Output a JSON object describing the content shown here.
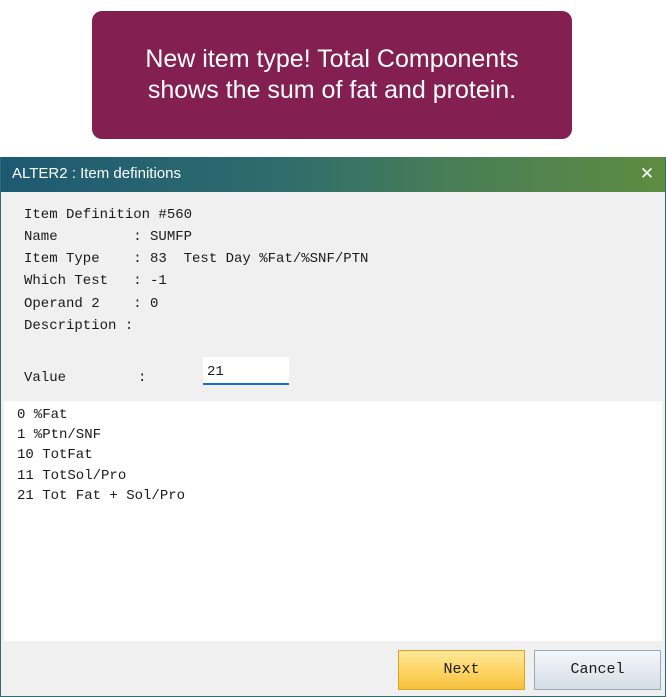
{
  "callout": {
    "line1": "New item type! Total Components",
    "line2": "shows the sum of fat and protein."
  },
  "window": {
    "title": "ALTER2 : Item definitions",
    "close_icon": "✕"
  },
  "definition": {
    "lines": [
      "Item Definition #560",
      "Name         : SUMFP",
      "Item Type    : 83  Test Day %Fat/%SNF/PTN",
      "Which Test   : -1",
      "Operand 2    : 0",
      "Description :"
    ]
  },
  "value_field": {
    "label": "Value",
    "colon": ":",
    "value": "21"
  },
  "options": [
    "0 %Fat",
    "1 %Ptn/SNF",
    "10 TotFat",
    "11 TotSol/Pro",
    "21 Tot Fat + Sol/Pro"
  ],
  "buttons": {
    "next_label": "Next",
    "cancel_label": "Cancel"
  },
  "colors": {
    "callout_bg": "#841f52",
    "next_button": "#fdd462",
    "input_underline": "#1c6ad3"
  }
}
